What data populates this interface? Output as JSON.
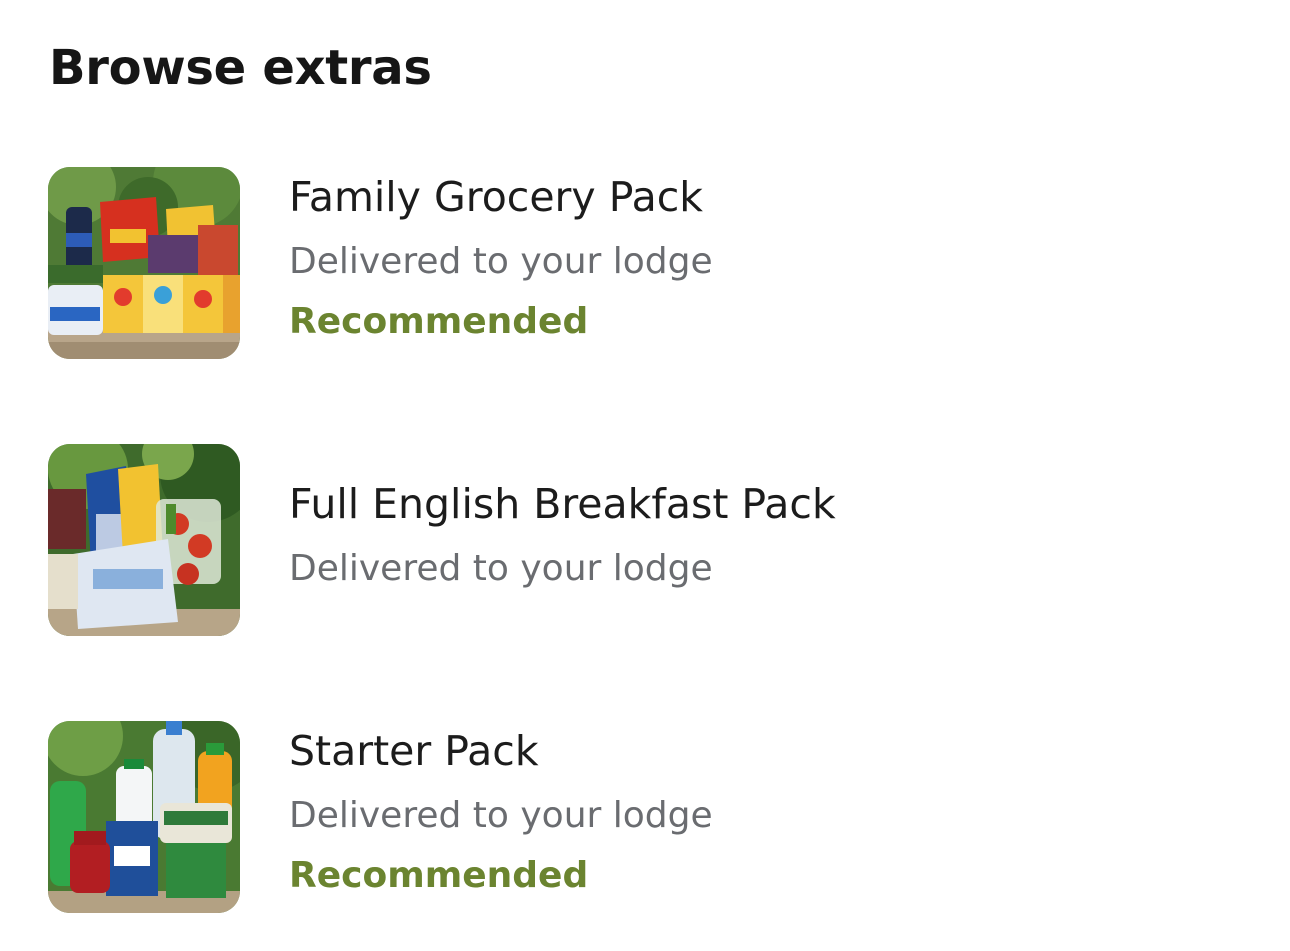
{
  "header": {
    "title": "Browse extras"
  },
  "colors": {
    "title": "#161616",
    "subtitle": "#6a6c70",
    "recommended": "#6b8430"
  },
  "extras": [
    {
      "title": "Family Grocery Pack",
      "subtitle": "Delivered to your lodge",
      "badge": "Recommended",
      "image": "family-grocery-pack-photo"
    },
    {
      "title": "Full English Breakfast Pack",
      "subtitle": "Delivered to your lodge",
      "badge": "",
      "image": "full-english-breakfast-pack-photo"
    },
    {
      "title": "Starter Pack",
      "subtitle": "Delivered to your lodge",
      "badge": "Recommended",
      "image": "starter-pack-photo"
    }
  ]
}
